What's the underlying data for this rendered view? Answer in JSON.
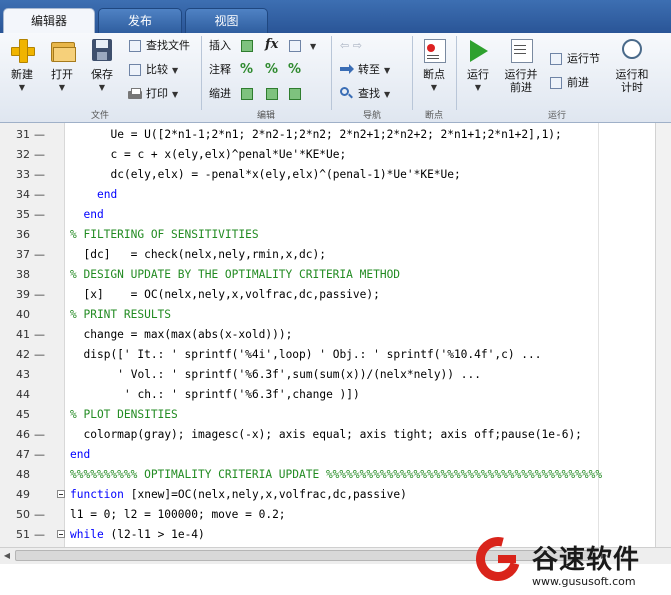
{
  "tabs": [
    {
      "label": "编辑器",
      "active": true
    },
    {
      "label": "发布",
      "active": false
    },
    {
      "label": "视图",
      "active": false
    }
  ],
  "ribbon": {
    "file": {
      "group_label": "文件",
      "new_label": "新建",
      "open_label": "打开",
      "save_label": "保存",
      "find_files_label": "查找文件",
      "compare_label": "比较",
      "print_label": "打印"
    },
    "edit": {
      "group_label": "编辑",
      "insert_label": "插入",
      "comment_label": "注释",
      "indent_label": "缩进",
      "fx_label": "fx"
    },
    "navigate": {
      "group_label": "导航",
      "goto_label": "转至",
      "find_label": "查找"
    },
    "breakpoints": {
      "group_label": "断点",
      "breakpoints_label": "断点"
    },
    "run": {
      "group_label": "运行",
      "run_label": "运行",
      "run_advance_label": "运行并\n前进",
      "run_section_label": "运行节",
      "advance_label": "前进",
      "run_time_label": "运行和\n计时"
    }
  },
  "editor": {
    "lines": [
      {
        "num": "31",
        "dash": "—",
        "indent": 6,
        "type": "code",
        "text": "Ue = U([2*n1-1;2*n1; 2*n2-1;2*n2; 2*n2+1;2*n2+2; 2*n1+1;2*n1+2],1);"
      },
      {
        "num": "32",
        "dash": "—",
        "indent": 6,
        "type": "code",
        "text": "c = c + x(ely,elx)^penal*Ue'*KE*Ue;"
      },
      {
        "num": "33",
        "dash": "—",
        "indent": 6,
        "type": "code",
        "text": "dc(ely,elx) = -penal*x(ely,elx)^(penal-1)*Ue'*KE*Ue;"
      },
      {
        "num": "34",
        "dash": "—",
        "indent": 4,
        "type": "kw",
        "text": "end"
      },
      {
        "num": "35",
        "dash": "—",
        "indent": 2,
        "type": "kw",
        "text": "end"
      },
      {
        "num": "36",
        "dash": "",
        "indent": 0,
        "type": "comment",
        "text": "% FILTERING OF SENSITIVITIES"
      },
      {
        "num": "37",
        "dash": "—",
        "indent": 2,
        "type": "code",
        "text": "[dc]   = check(nelx,nely,rmin,x,dc);"
      },
      {
        "num": "38",
        "dash": "",
        "indent": 0,
        "type": "comment",
        "text": "% DESIGN UPDATE BY THE OPTIMALITY CRITERIA METHOD"
      },
      {
        "num": "39",
        "dash": "—",
        "indent": 2,
        "type": "code",
        "text": "[x]    = OC(nelx,nely,x,volfrac,dc,passive);"
      },
      {
        "num": "40",
        "dash": "",
        "indent": 0,
        "type": "comment",
        "text": "% PRINT RESULTS"
      },
      {
        "num": "41",
        "dash": "—",
        "indent": 2,
        "type": "code",
        "text": "change = max(max(abs(x-xold)));"
      },
      {
        "num": "42",
        "dash": "—",
        "indent": 2,
        "type": "code",
        "text": "disp([' It.: ' sprintf('%4i',loop) ' Obj.: ' sprintf('%10.4f',c) ..."
      },
      {
        "num": "43",
        "dash": "",
        "indent": 7,
        "type": "code",
        "text": "' Vol.: ' sprintf('%6.3f',sum(sum(x))/(nelx*nely)) ..."
      },
      {
        "num": "44",
        "dash": "",
        "indent": 8,
        "type": "code",
        "text": "' ch.: ' sprintf('%6.3f',change )])"
      },
      {
        "num": "45",
        "dash": "",
        "indent": 0,
        "type": "comment",
        "text": "% PLOT DENSITIES"
      },
      {
        "num": "46",
        "dash": "—",
        "indent": 2,
        "type": "code",
        "text": "colormap(gray); imagesc(-x); axis equal; axis tight; axis off;pause(1e-6);"
      },
      {
        "num": "47",
        "dash": "—",
        "indent": 0,
        "type": "kw",
        "text": "end"
      },
      {
        "num": "48",
        "dash": "",
        "indent": 0,
        "type": "comment",
        "text": "%%%%%%%%%% OPTIMALITY CRITERIA UPDATE %%%%%%%%%%%%%%%%%%%%%%%%%%%%%%%%%%%%%%%%%"
      },
      {
        "num": "49",
        "dash": "",
        "indent": 0,
        "type": "func",
        "text": "function [xnew]=OC(nelx,nely,x,volfrac,dc,passive)"
      },
      {
        "num": "50",
        "dash": "—",
        "indent": 0,
        "type": "code",
        "text": "l1 = 0; l2 = 100000; move = 0.2;"
      },
      {
        "num": "51",
        "dash": "—",
        "indent": 0,
        "type": "while",
        "text": "while (l2-l1 > 1e-4)"
      }
    ]
  },
  "watermark": {
    "brand": "谷速软件",
    "url": "www.gususoft.com"
  },
  "colors": {
    "accent": "#2a5597",
    "comment": "#228b22",
    "keyword": "#0000ff",
    "watermark_red": "#d9241b"
  }
}
